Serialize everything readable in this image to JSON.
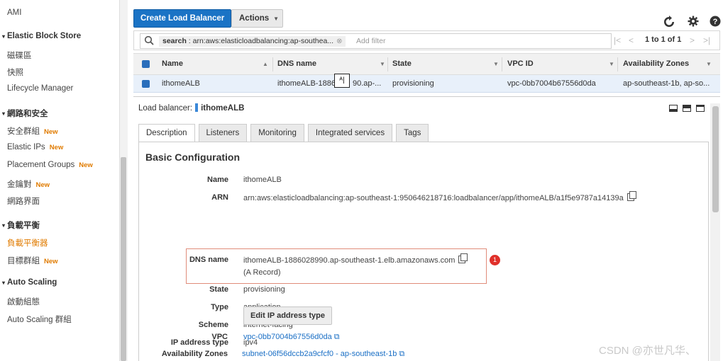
{
  "sidebar": {
    "ami": "AMI",
    "ebs": {
      "title": "Elastic Block Store",
      "items": [
        "磁碟區",
        "快照",
        "Lifecycle Manager"
      ]
    },
    "network": {
      "title": "網路和安全",
      "items": [
        {
          "label": "安全群組",
          "badge": "New"
        },
        {
          "label": "Elastic IPs",
          "badge": "New"
        },
        {
          "label": "Placement Groups",
          "badge": "New"
        },
        {
          "label": "金鑰對",
          "badge": "New"
        },
        {
          "label": "網路界面",
          "badge": ""
        }
      ]
    },
    "lb": {
      "title": "負載平衡",
      "items": [
        {
          "label": "負載平衡器",
          "badge": "",
          "active": true
        },
        {
          "label": "目標群組",
          "badge": "New",
          "active": false
        }
      ]
    },
    "autoscaling": {
      "title": "Auto Scaling",
      "items": [
        "啟動組態",
        "Auto Scaling 群組"
      ]
    }
  },
  "toolbar": {
    "create_label": "Create Load Balancer",
    "actions_label": "Actions",
    "refresh_icon": "refresh-icon",
    "settings_icon": "gear-icon",
    "help_icon": "help-icon"
  },
  "filter": {
    "tag_key": "search",
    "tag_value": " : arn:aws:elasticloadbalancing:ap-southea...",
    "placeholder": "Add filter",
    "pager_text": "1 to 1 of 1"
  },
  "table": {
    "columns": [
      "Name",
      "DNS name",
      "State",
      "VPC ID",
      "Availability Zones"
    ],
    "rows": [
      {
        "name": "ithomeALB",
        "dns": "ithomeALB-1886",
        "dns_tail": "90.ap-...",
        "state": "provisioning",
        "vpc": "vpc-0bb7004b67556d0da",
        "az": "ap-southeast-1b, ap-so..."
      }
    ]
  },
  "detail": {
    "lb_label": "Load balancer:",
    "lb_name": "ithomeALB",
    "tabs": [
      "Description",
      "Listeners",
      "Monitoring",
      "Integrated services",
      "Tags"
    ],
    "active_tab": "Description",
    "section_title": "Basic Configuration",
    "fields": {
      "name": {
        "label": "Name",
        "value": "ithomeALB"
      },
      "arn": {
        "label": "ARN",
        "value": "arn:aws:elasticloadbalancing:ap-southeast-1:950646218716:loadbalancer/app/ithomeALB/a1f5e9787a14139a"
      },
      "dns": {
        "label": "DNS name",
        "value": "ithomeALB-1886028990.ap-southeast-1.elb.amazonaws.com",
        "sub": "(A Record)"
      },
      "state": {
        "label": "State",
        "value": "provisioning"
      },
      "type": {
        "label": "Type",
        "value": "application"
      },
      "scheme": {
        "label": "Scheme",
        "value": "internet-facing"
      },
      "ip_type": {
        "label": "IP address type",
        "value": "ipv4"
      },
      "vpc": {
        "label": "VPC",
        "value": "vpc-0bb7004b67556d0da"
      },
      "az": {
        "label": "Availability Zones",
        "value": "subnet-06f56dccb2a9cfcf0 - ap-southeast-1b"
      }
    },
    "edit_ip_label": "Edit IP address type",
    "annotation_number": "1"
  },
  "overlay": {
    "cursor_text": "ᴬ|",
    "watermark": "CSDN @亦世凡华、"
  },
  "colors": {
    "primary_button": "#1a73c5",
    "link": "#1a6fc5",
    "active_nav": "#e07b00",
    "selected_row": "#e8f0fa",
    "annotation_box": "#e08c7a",
    "annotation_badge": "#e0302a"
  }
}
